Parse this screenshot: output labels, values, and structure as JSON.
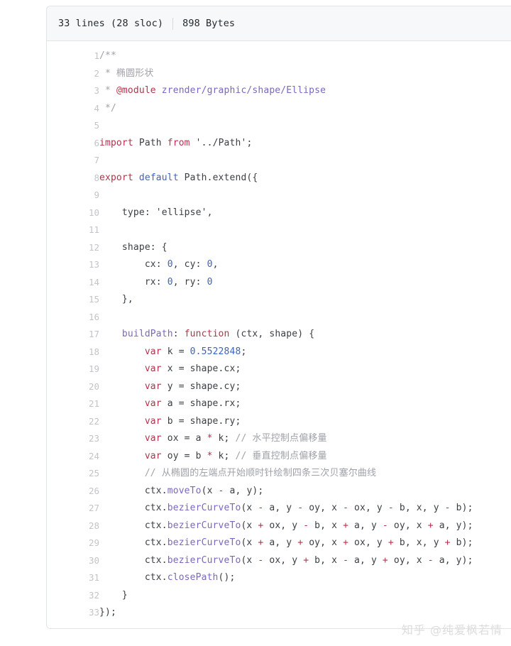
{
  "blob": {
    "header": {
      "lines_label": "33 lines (28 sloc)",
      "size_label": "898 Bytes"
    },
    "lines": [
      {
        "n": "1",
        "tokens": [
          {
            "t": "/**",
            "c": "cmt"
          }
        ]
      },
      {
        "n": "2",
        "tokens": [
          {
            "t": " * 椭圆形状",
            "c": "cmt"
          }
        ]
      },
      {
        "n": "3",
        "tokens": [
          {
            "t": " * ",
            "c": "cmt"
          },
          {
            "t": "@module",
            "c": "tag"
          },
          {
            "t": " ",
            "c": "cmt"
          },
          {
            "t": "zrender/graphic/shape/Ellipse",
            "c": "mod"
          }
        ]
      },
      {
        "n": "4",
        "tokens": [
          {
            "t": " */",
            "c": "cmt"
          }
        ]
      },
      {
        "n": "5",
        "tokens": [
          {
            "t": "",
            "c": "pln"
          }
        ]
      },
      {
        "n": "6",
        "tokens": [
          {
            "t": "import",
            "c": "kw"
          },
          {
            "t": " Path ",
            "c": "pln"
          },
          {
            "t": "from",
            "c": "kw"
          },
          {
            "t": " ",
            "c": "pln"
          },
          {
            "t": "'../Path'",
            "c": "str"
          },
          {
            "t": ";",
            "c": "pln"
          }
        ]
      },
      {
        "n": "7",
        "tokens": [
          {
            "t": "",
            "c": "pln"
          }
        ]
      },
      {
        "n": "8",
        "tokens": [
          {
            "t": "export",
            "c": "kw"
          },
          {
            "t": " ",
            "c": "pln"
          },
          {
            "t": "default",
            "c": "kw2"
          },
          {
            "t": " Path.extend({",
            "c": "pln"
          }
        ]
      },
      {
        "n": "9",
        "tokens": [
          {
            "t": "",
            "c": "pln"
          }
        ]
      },
      {
        "n": "10",
        "tokens": [
          {
            "t": "    type: ",
            "c": "pln"
          },
          {
            "t": "'ellipse'",
            "c": "str"
          },
          {
            "t": ",",
            "c": "pln"
          }
        ]
      },
      {
        "n": "11",
        "tokens": [
          {
            "t": "",
            "c": "pln"
          }
        ]
      },
      {
        "n": "12",
        "tokens": [
          {
            "t": "    shape: {",
            "c": "pln"
          }
        ]
      },
      {
        "n": "13",
        "tokens": [
          {
            "t": "        cx: ",
            "c": "pln"
          },
          {
            "t": "0",
            "c": "num"
          },
          {
            "t": ", cy: ",
            "c": "pln"
          },
          {
            "t": "0",
            "c": "num"
          },
          {
            "t": ",",
            "c": "pln"
          }
        ]
      },
      {
        "n": "14",
        "tokens": [
          {
            "t": "        rx: ",
            "c": "pln"
          },
          {
            "t": "0",
            "c": "num"
          },
          {
            "t": ", ry: ",
            "c": "pln"
          },
          {
            "t": "0",
            "c": "num"
          }
        ]
      },
      {
        "n": "15",
        "tokens": [
          {
            "t": "    },",
            "c": "pln"
          }
        ]
      },
      {
        "n": "16",
        "tokens": [
          {
            "t": "",
            "c": "pln"
          }
        ]
      },
      {
        "n": "17",
        "tokens": [
          {
            "t": "    ",
            "c": "pln"
          },
          {
            "t": "buildPath",
            "c": "fn"
          },
          {
            "t": ": ",
            "c": "pln"
          },
          {
            "t": "function",
            "c": "kw"
          },
          {
            "t": " (ctx, shape) {",
            "c": "pln"
          }
        ]
      },
      {
        "n": "18",
        "tokens": [
          {
            "t": "        ",
            "c": "pln"
          },
          {
            "t": "var",
            "c": "kw"
          },
          {
            "t": " k = ",
            "c": "pln"
          },
          {
            "t": "0.5522848",
            "c": "num"
          },
          {
            "t": ";",
            "c": "pln"
          }
        ]
      },
      {
        "n": "19",
        "tokens": [
          {
            "t": "        ",
            "c": "pln"
          },
          {
            "t": "var",
            "c": "kw"
          },
          {
            "t": " x = shape.cx;",
            "c": "pln"
          }
        ]
      },
      {
        "n": "20",
        "tokens": [
          {
            "t": "        ",
            "c": "pln"
          },
          {
            "t": "var",
            "c": "kw"
          },
          {
            "t": " y = shape.cy;",
            "c": "pln"
          }
        ]
      },
      {
        "n": "21",
        "tokens": [
          {
            "t": "        ",
            "c": "pln"
          },
          {
            "t": "var",
            "c": "kw"
          },
          {
            "t": " a = shape.rx;",
            "c": "pln"
          }
        ]
      },
      {
        "n": "22",
        "tokens": [
          {
            "t": "        ",
            "c": "pln"
          },
          {
            "t": "var",
            "c": "kw"
          },
          {
            "t": " b = shape.ry;",
            "c": "pln"
          }
        ]
      },
      {
        "n": "23",
        "tokens": [
          {
            "t": "        ",
            "c": "pln"
          },
          {
            "t": "var",
            "c": "kw"
          },
          {
            "t": " ox = a ",
            "c": "pln"
          },
          {
            "t": "*",
            "c": "op"
          },
          {
            "t": " k; ",
            "c": "pln"
          },
          {
            "t": "// 水平控制点偏移量",
            "c": "cmt"
          }
        ]
      },
      {
        "n": "24",
        "tokens": [
          {
            "t": "        ",
            "c": "pln"
          },
          {
            "t": "var",
            "c": "kw"
          },
          {
            "t": " oy = b ",
            "c": "pln"
          },
          {
            "t": "*",
            "c": "op"
          },
          {
            "t": " k; ",
            "c": "pln"
          },
          {
            "t": "// 垂直控制点偏移量",
            "c": "cmt"
          }
        ]
      },
      {
        "n": "25",
        "tokens": [
          {
            "t": "        ",
            "c": "pln"
          },
          {
            "t": "// 从椭圆的左端点开始顺时针绘制四条三次贝塞尔曲线",
            "c": "cmt"
          }
        ]
      },
      {
        "n": "26",
        "tokens": [
          {
            "t": "        ctx.",
            "c": "pln"
          },
          {
            "t": "moveTo",
            "c": "fn"
          },
          {
            "t": "(x ",
            "c": "pln"
          },
          {
            "t": "-",
            "c": "op"
          },
          {
            "t": " a, y);",
            "c": "pln"
          }
        ]
      },
      {
        "n": "27",
        "tokens": [
          {
            "t": "        ctx.",
            "c": "pln"
          },
          {
            "t": "bezierCurveTo",
            "c": "fn"
          },
          {
            "t": "(x ",
            "c": "pln"
          },
          {
            "t": "-",
            "c": "op"
          },
          {
            "t": " a, y ",
            "c": "pln"
          },
          {
            "t": "-",
            "c": "op"
          },
          {
            "t": " oy, x ",
            "c": "pln"
          },
          {
            "t": "-",
            "c": "op"
          },
          {
            "t": " ox, y ",
            "c": "pln"
          },
          {
            "t": "-",
            "c": "op"
          },
          {
            "t": " b, x, y ",
            "c": "pln"
          },
          {
            "t": "-",
            "c": "op"
          },
          {
            "t": " b);",
            "c": "pln"
          }
        ]
      },
      {
        "n": "28",
        "tokens": [
          {
            "t": "        ctx.",
            "c": "pln"
          },
          {
            "t": "bezierCurveTo",
            "c": "fn"
          },
          {
            "t": "(x ",
            "c": "pln"
          },
          {
            "t": "+",
            "c": "op"
          },
          {
            "t": " ox, y ",
            "c": "pln"
          },
          {
            "t": "-",
            "c": "op"
          },
          {
            "t": " b, x ",
            "c": "pln"
          },
          {
            "t": "+",
            "c": "op"
          },
          {
            "t": " a, y ",
            "c": "pln"
          },
          {
            "t": "-",
            "c": "op"
          },
          {
            "t": " oy, x ",
            "c": "pln"
          },
          {
            "t": "+",
            "c": "op"
          },
          {
            "t": " a, y);",
            "c": "pln"
          }
        ]
      },
      {
        "n": "29",
        "tokens": [
          {
            "t": "        ctx.",
            "c": "pln"
          },
          {
            "t": "bezierCurveTo",
            "c": "fn"
          },
          {
            "t": "(x ",
            "c": "pln"
          },
          {
            "t": "+",
            "c": "op"
          },
          {
            "t": " a, y ",
            "c": "pln"
          },
          {
            "t": "+",
            "c": "op"
          },
          {
            "t": " oy, x ",
            "c": "pln"
          },
          {
            "t": "+",
            "c": "op"
          },
          {
            "t": " ox, y ",
            "c": "pln"
          },
          {
            "t": "+",
            "c": "op"
          },
          {
            "t": " b, x, y ",
            "c": "pln"
          },
          {
            "t": "+",
            "c": "op"
          },
          {
            "t": " b);",
            "c": "pln"
          }
        ]
      },
      {
        "n": "30",
        "tokens": [
          {
            "t": "        ctx.",
            "c": "pln"
          },
          {
            "t": "bezierCurveTo",
            "c": "fn"
          },
          {
            "t": "(x ",
            "c": "pln"
          },
          {
            "t": "-",
            "c": "op"
          },
          {
            "t": " ox, y ",
            "c": "pln"
          },
          {
            "t": "+",
            "c": "op"
          },
          {
            "t": " b, x ",
            "c": "pln"
          },
          {
            "t": "-",
            "c": "op"
          },
          {
            "t": " a, y ",
            "c": "pln"
          },
          {
            "t": "+",
            "c": "op"
          },
          {
            "t": " oy, x ",
            "c": "pln"
          },
          {
            "t": "-",
            "c": "op"
          },
          {
            "t": " a, y);",
            "c": "pln"
          }
        ]
      },
      {
        "n": "31",
        "tokens": [
          {
            "t": "        ctx.",
            "c": "pln"
          },
          {
            "t": "closePath",
            "c": "fn"
          },
          {
            "t": "();",
            "c": "pln"
          }
        ]
      },
      {
        "n": "32",
        "tokens": [
          {
            "t": "    }",
            "c": "pln"
          }
        ]
      },
      {
        "n": "33",
        "tokens": [
          {
            "t": "});",
            "c": "pln"
          }
        ]
      }
    ]
  },
  "watermark": {
    "text": "知乎 @纯爱枫若情"
  },
  "colors": {
    "header_bg": "#f6f8fa",
    "border": "#e1e4e8",
    "text": "#24292e",
    "line_number": "#c2c4c7",
    "keyword": "#b9304a",
    "keyword_alt": "#3a62c8",
    "comment": "#9ea2a8",
    "identifier": "#7c66c4",
    "number": "#3a62c8",
    "watermark": "#dcdcdc"
  }
}
